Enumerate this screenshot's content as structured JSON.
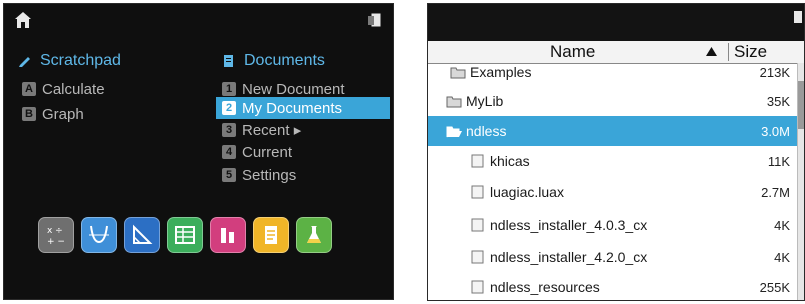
{
  "home": {
    "scratchpad_heading": "Scratchpad",
    "documents_heading": "Documents",
    "scratchpad_items": [
      {
        "key": "A",
        "label": "Calculate"
      },
      {
        "key": "B",
        "label": "Graph"
      }
    ],
    "document_items": [
      {
        "key": "1",
        "label": "New Document"
      },
      {
        "key": "2",
        "label": "My Documents",
        "selected": true
      },
      {
        "key": "3",
        "label": "Recent ▸"
      },
      {
        "key": "4",
        "label": "Current"
      },
      {
        "key": "5",
        "label": "Settings"
      }
    ],
    "apps": [
      {
        "name": "calculator-app",
        "icon": "calculator-icon",
        "color": "#6f6f6f"
      },
      {
        "name": "graphs-app",
        "icon": "graph-icon",
        "color": "#3f8fd8"
      },
      {
        "name": "geometry-app",
        "icon": "geometry-icon",
        "color": "#2c6fc4"
      },
      {
        "name": "lists-spreadsheet-app",
        "icon": "spreadsheet-icon",
        "color": "#3cae5c"
      },
      {
        "name": "data-statistics-app",
        "icon": "data-icon",
        "color": "#d23e7e"
      },
      {
        "name": "notes-app",
        "icon": "notes-icon",
        "color": "#f0b528"
      },
      {
        "name": "vernier-dataquest-app",
        "icon": "flask-icon",
        "color": "#5cb245"
      }
    ]
  },
  "browser": {
    "column_name": "Name",
    "column_size": "Size",
    "rows": [
      {
        "name": "Examples",
        "size": "213K",
        "type": "folder",
        "indent": 0,
        "selected": false
      },
      {
        "name": "MyLib",
        "size": "35K",
        "type": "folder",
        "indent": 0,
        "selected": false
      },
      {
        "name": "ndless",
        "size": "3.0M",
        "type": "folder-open",
        "indent": 0,
        "selected": true
      },
      {
        "name": "khicas",
        "size": "11K",
        "type": "file",
        "indent": 1,
        "selected": false
      },
      {
        "name": "luagiac.luax",
        "size": "2.7M",
        "type": "file",
        "indent": 1,
        "selected": false
      },
      {
        "name": "ndless_installer_4.0.3_cx",
        "size": "4K",
        "type": "file",
        "indent": 1,
        "selected": false
      },
      {
        "name": "ndless_installer_4.2.0_cx",
        "size": "4K",
        "type": "file",
        "indent": 1,
        "selected": false
      },
      {
        "name": "ndless_resources",
        "size": "255K",
        "type": "file",
        "indent": 1,
        "selected": false
      }
    ]
  },
  "colors": {
    "accent": "#3aa5d8",
    "heading_blue": "#5fb8e8",
    "screen_bg": "#0f0f0f"
  }
}
